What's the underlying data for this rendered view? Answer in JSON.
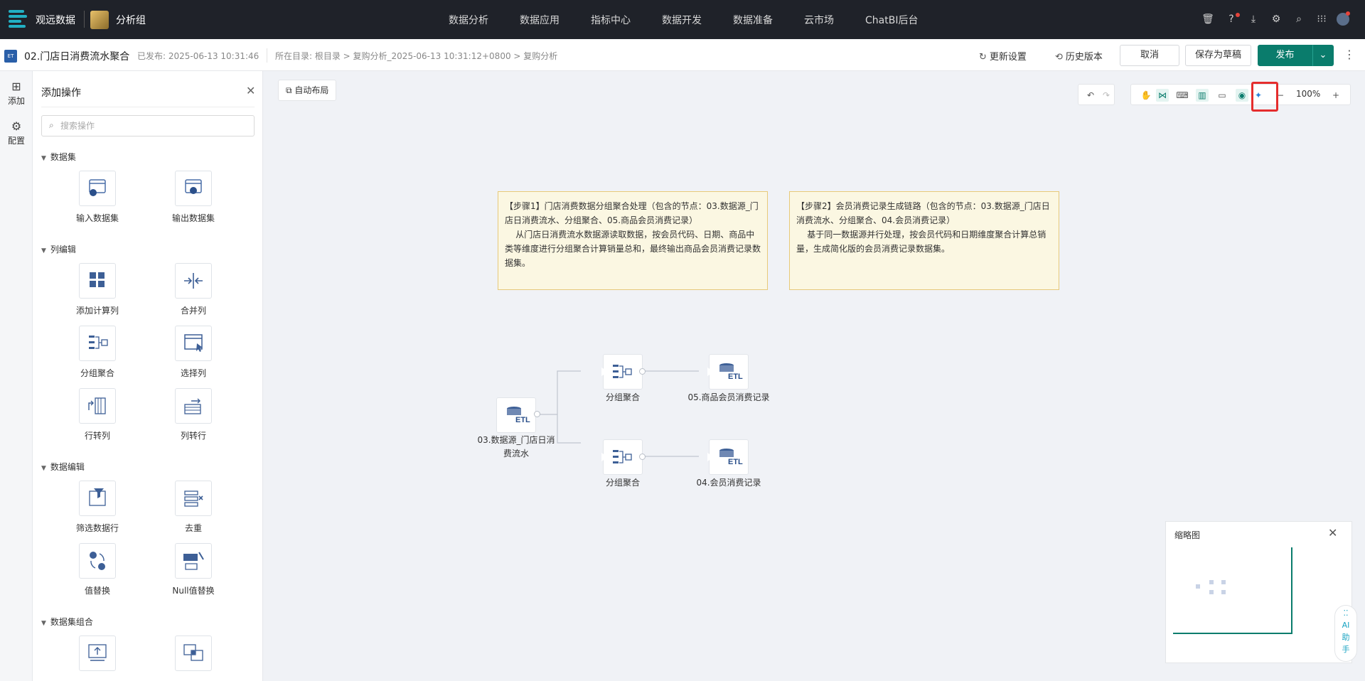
{
  "brand": "观远数据",
  "group": "分析组",
  "nav": [
    "数据分析",
    "数据应用",
    "指标中心",
    "数据开发",
    "数据准备",
    "云市场",
    "ChatBI后台"
  ],
  "doc": {
    "badge": "ET",
    "title": "02.门店日消费流水聚合",
    "published": "已发布: 2025-06-13 10:31:46",
    "path": "所在目录: 根目录 > 复购分析_2025-06-13 10:31:12+0800 > 复购分析"
  },
  "actions": {
    "update": "更新设置",
    "history": "历史版本",
    "cancel": "取消",
    "draft": "保存为草稿",
    "publish": "发布"
  },
  "rail": [
    "添加",
    "配置"
  ],
  "panel": {
    "title": "添加操作",
    "search_placeholder": "搜索操作",
    "sections": [
      {
        "title": "数据集",
        "items": [
          "输入数据集",
          "输出数据集"
        ]
      },
      {
        "title": "列编辑",
        "items": [
          "添加计算列",
          "合并列",
          "分组聚合",
          "选择列",
          "行转列",
          "列转行"
        ]
      },
      {
        "title": "数据编辑",
        "items": [
          "筛选数据行",
          "去重",
          "值替换",
          "Null值替换"
        ]
      },
      {
        "title": "数据集组合",
        "items": [
          "",
          ""
        ]
      }
    ]
  },
  "canvas": {
    "auto_layout": "自动布局",
    "zoom": "100%",
    "notes": [
      {
        "title": "【步骤1】门店消费数据分组聚合处理（包含的节点：03.数据源_门店日消费流水、分组聚合、05.商品会员消费记录）",
        "body": "    从门店日消费流水数据源读取数据，按会员代码、日期、商品中类等维度进行分组聚合计算销量总和，最终输出商品会员消费记录数据集。"
      },
      {
        "title": "【步骤2】会员消费记录生成链路（包含的节点：03.数据源_门店日消费流水、分组聚合、04.会员消费记录）",
        "body": "    基于同一数据源并行处理，按会员代码和日期维度聚合计算总销量，生成简化版的会员消费记录数据集。"
      }
    ],
    "nodes": {
      "source": "03.数据源_门店日消费流水",
      "agg1": "分组聚合",
      "out1": "05.商品会员消费记录",
      "agg2": "分组聚合",
      "out2": "04.会员消费记录"
    }
  },
  "minimap": {
    "title": "缩略图"
  },
  "ai": {
    "label_top": "AI",
    "label_1": "助",
    "label_2": "手"
  },
  "colors": {
    "primary": "#0a7c6c",
    "topbar": "#1f2229",
    "highlight": "#e52d2d",
    "note_bg": "#fbf7e2"
  }
}
